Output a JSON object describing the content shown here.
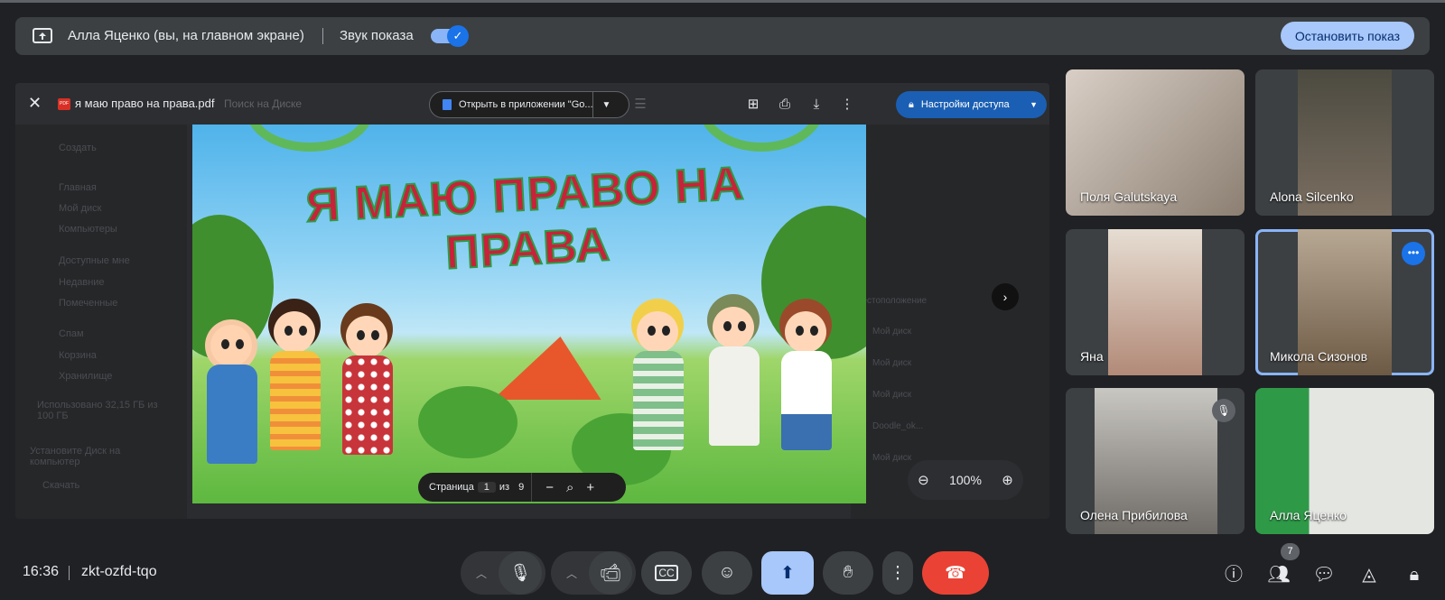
{
  "banner": {
    "presenter_text": "Алла Яценко (вы, на главном экране)",
    "sound_label": "Звук показа",
    "sound_on": true,
    "stop_label": "Остановить показ"
  },
  "shared": {
    "file_name": "я маю право на права.pdf",
    "search_hint": "Поиск на Диске",
    "open_app_label": "Открыть в приложении \"Go...",
    "access_label": "Настройки доступа",
    "slide_title": "Я МАЮ ПРАВО НА ПРАВА",
    "pager": {
      "page_label": "Страница",
      "page": "1",
      "of_label": "из",
      "total": "9"
    },
    "zoom_value": "100%",
    "drive_side": [
      "Создать",
      "Главная",
      "Мой диск",
      "Компьютеры",
      "Доступные мне",
      "Недавние",
      "Помеченные",
      "Спам",
      "Корзина",
      "Хранилище",
      "Использовано 32,15 ГБ из 100 ГБ",
      "Установите Диск на компьютер",
      "Скачать"
    ],
    "drive_right": [
      "Местоположение",
      "Мой диск",
      "Мой диск",
      "Мой диск",
      "Doodle_ok...",
      "Мой диск"
    ]
  },
  "participants": [
    {
      "name": "Поля Galutskaya",
      "bg": "#b9a89a"
    },
    {
      "name": "Alona Silcenko",
      "bg": "#5a5448"
    },
    {
      "name": "Яна",
      "bg": "#d8cfc3"
    },
    {
      "name": "Микола Сизонов",
      "bg": "#8a7a66",
      "active": true
    },
    {
      "name": "Олена Прибилова",
      "bg": "#8b8a86",
      "muted": true
    },
    {
      "name": "Алла Яценко",
      "bg": "#cfd4cd"
    }
  ],
  "bottom": {
    "time": "16:36",
    "meeting_code": "zkt-ozfd-tqo",
    "people_count": "7"
  },
  "icons": {
    "mic": "microphone-icon",
    "cam": "camera-icon",
    "cc": "captions-icon",
    "emoji": "emoji-icon",
    "present": "present-screen-icon",
    "hand": "raise-hand-icon",
    "more": "more-vert-icon",
    "hangup": "hang-up-icon"
  },
  "colors": {
    "accent": "#8ab4f8",
    "hangup": "#ea4335",
    "present_active": "#a8c7fa"
  }
}
